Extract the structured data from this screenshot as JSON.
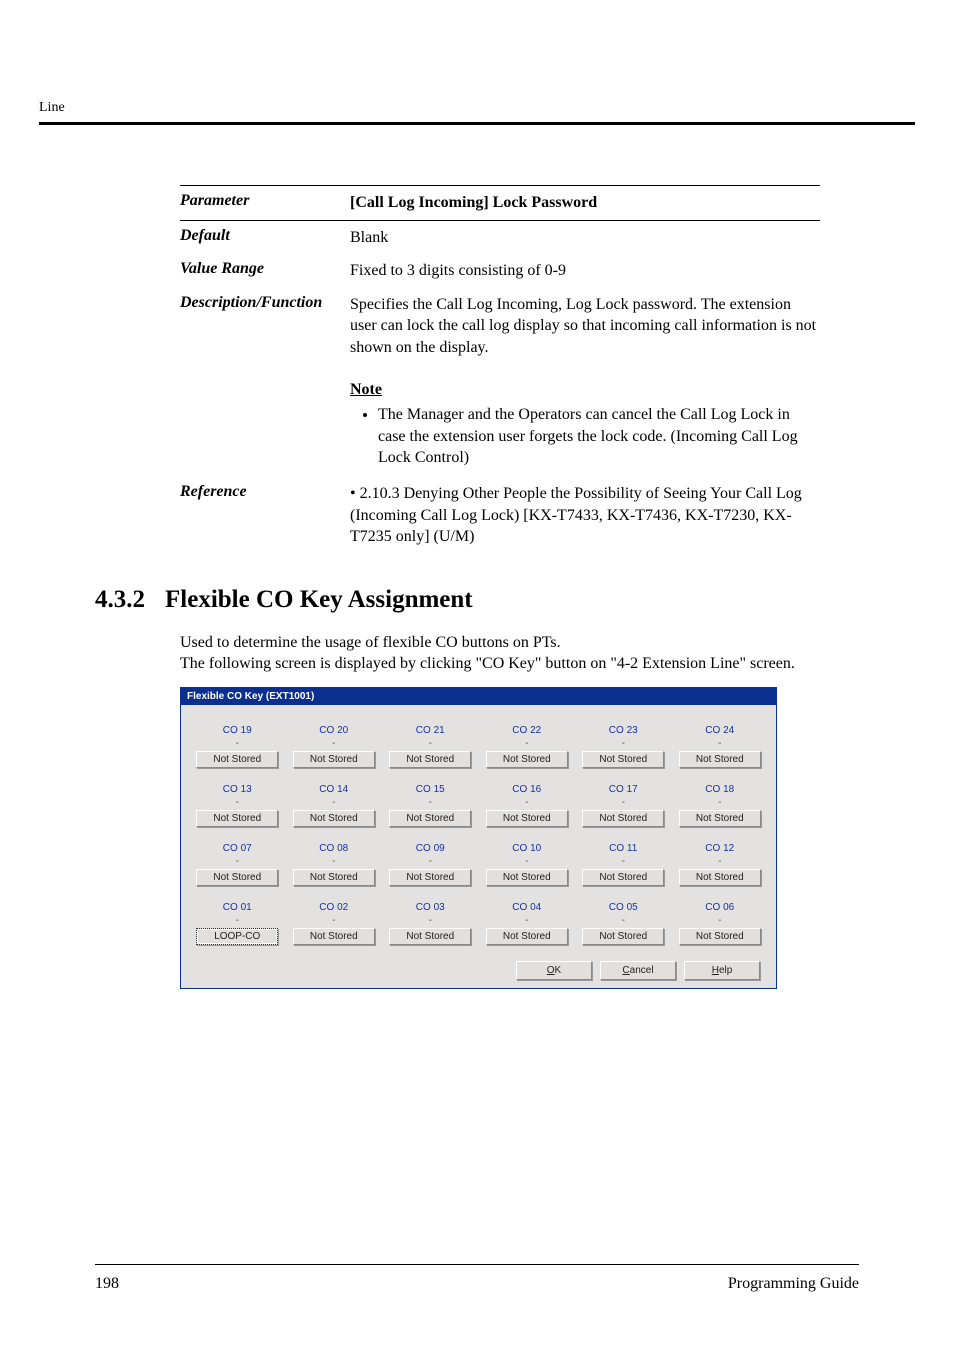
{
  "header": {
    "label": "Line"
  },
  "param": {
    "labels": {
      "parameter": "Parameter",
      "default": "Default",
      "value_range": "Value Range",
      "description_function": "Description/Function",
      "reference": "Reference"
    },
    "title": "[Call Log Incoming] Lock Password",
    "default": "Blank",
    "value_range": "Fixed to 3 digits consisting of 0-9",
    "description": "Specifies the Call Log Incoming, Log Lock password. The extension user can lock the call log display so that incoming call information is not shown on the display.",
    "note_heading": "Note",
    "note_item": "The Manager and the Operators can cancel the Call Log Lock in case the extension user forgets the lock code. (Incoming Call Log Lock Control)",
    "reference": "• 2.10.3 Denying Other People the Possibility of Seeing Your Call Log (Incoming Call Log Lock) [KX-T7433, KX-T7436, KX-T7230, KX-T7235 only] (U/M)"
  },
  "section": {
    "number": "4.3.2",
    "title": "Flexible CO Key Assignment"
  },
  "intro": {
    "line1": "Used to determine the usage of flexible CO buttons on PTs.",
    "line2": "The following screen is displayed by clicking \"CO Key\" button on \"4-2 Extension Line\" screen."
  },
  "app": {
    "title": "Flexible CO Key (EXT1001)",
    "not_stored": "Not Stored",
    "dash": "-",
    "rows": [
      [
        "CO 19",
        "CO 20",
        "CO 21",
        "CO 22",
        "CO 23",
        "CO 24"
      ],
      [
        "CO 13",
        "CO 14",
        "CO 15",
        "CO 16",
        "CO 17",
        "CO 18"
      ],
      [
        "CO 07",
        "CO 08",
        "CO 09",
        "CO 10",
        "CO 11",
        "CO 12"
      ],
      [
        "CO 01",
        "CO 02",
        "CO 03",
        "CO 04",
        "CO 05",
        "CO 06"
      ]
    ],
    "selected_btn": "LOOP-CO",
    "buttons": {
      "ok_u": "O",
      "ok_rest": "K",
      "cancel_u": "C",
      "cancel_rest": "ancel",
      "help_u": "H",
      "help_rest": "elp"
    }
  },
  "footer": {
    "page": "198",
    "doc": "Programming Guide"
  }
}
